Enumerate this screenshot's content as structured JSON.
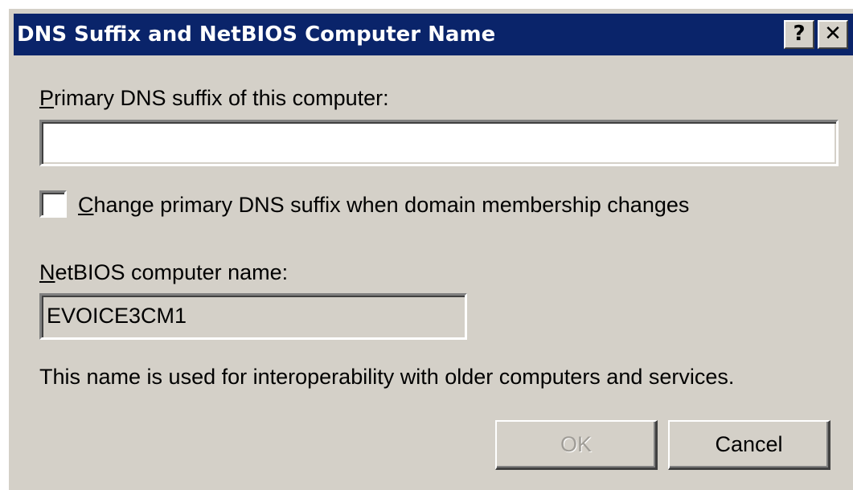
{
  "window": {
    "title": "DNS Suffix and NetBIOS Computer Name",
    "help_glyph": "?",
    "close_glyph": "✕"
  },
  "primary_dns": {
    "label_accel": "P",
    "label_rest": "rimary DNS suffix of this computer:",
    "value": ""
  },
  "change_suffix": {
    "label_accel": "C",
    "label_rest": "hange primary DNS suffix when domain membership changes",
    "checked": false
  },
  "netbios": {
    "label_accel": "N",
    "label_rest": "etBIOS computer name:",
    "value": "EVOICE3CM1"
  },
  "info_text": "This name is used for interoperability with older computers and services.",
  "buttons": {
    "ok": {
      "label": "OK",
      "enabled": false
    },
    "cancel": {
      "label": "Cancel",
      "enabled": true
    }
  },
  "colors": {
    "titlebar": "#0a246a",
    "dialog_face": "#d4d0c8",
    "disabled_text": "#a09d97"
  }
}
